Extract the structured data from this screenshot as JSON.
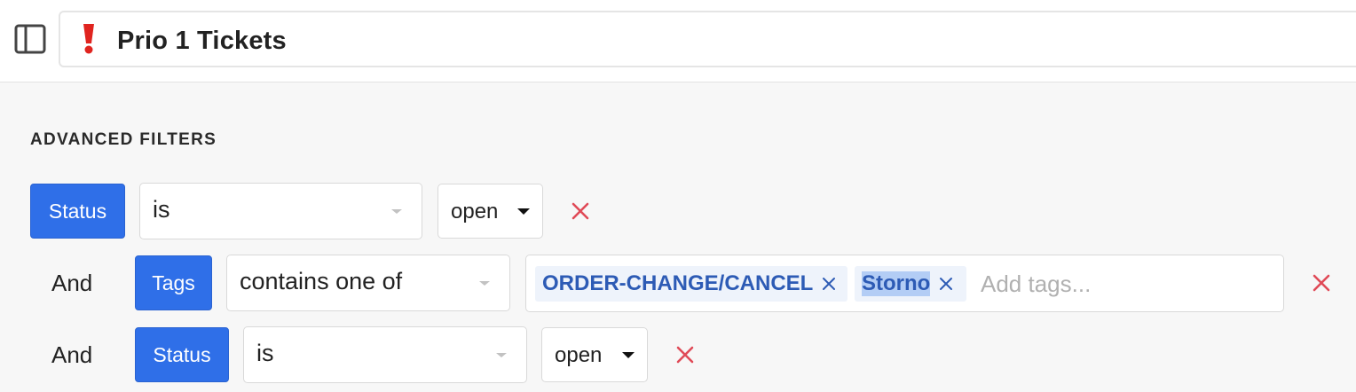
{
  "header": {
    "sidebar_toggle_icon": "sidebar-panel-icon",
    "title_icon": "exclamation-mark-icon",
    "title": "Prio 1 Tickets",
    "emoji_color": "#e0241f"
  },
  "filters": {
    "heading": "ADVANCED FILTERS",
    "accent_color": "#2f6fe8",
    "remove_color": "#e04a57",
    "rows": [
      {
        "connector": "",
        "field": "Status",
        "operator": "is",
        "value": "open"
      },
      {
        "connector": "And",
        "field": "Tags",
        "operator": "contains one of",
        "tags": [
          {
            "label": "ORDER-CHANGE/CANCEL"
          },
          {
            "label": "Storno"
          }
        ],
        "tags_placeholder": "Add tags..."
      },
      {
        "connector": "And",
        "field": "Status",
        "operator": "is",
        "value": "open"
      }
    ]
  }
}
